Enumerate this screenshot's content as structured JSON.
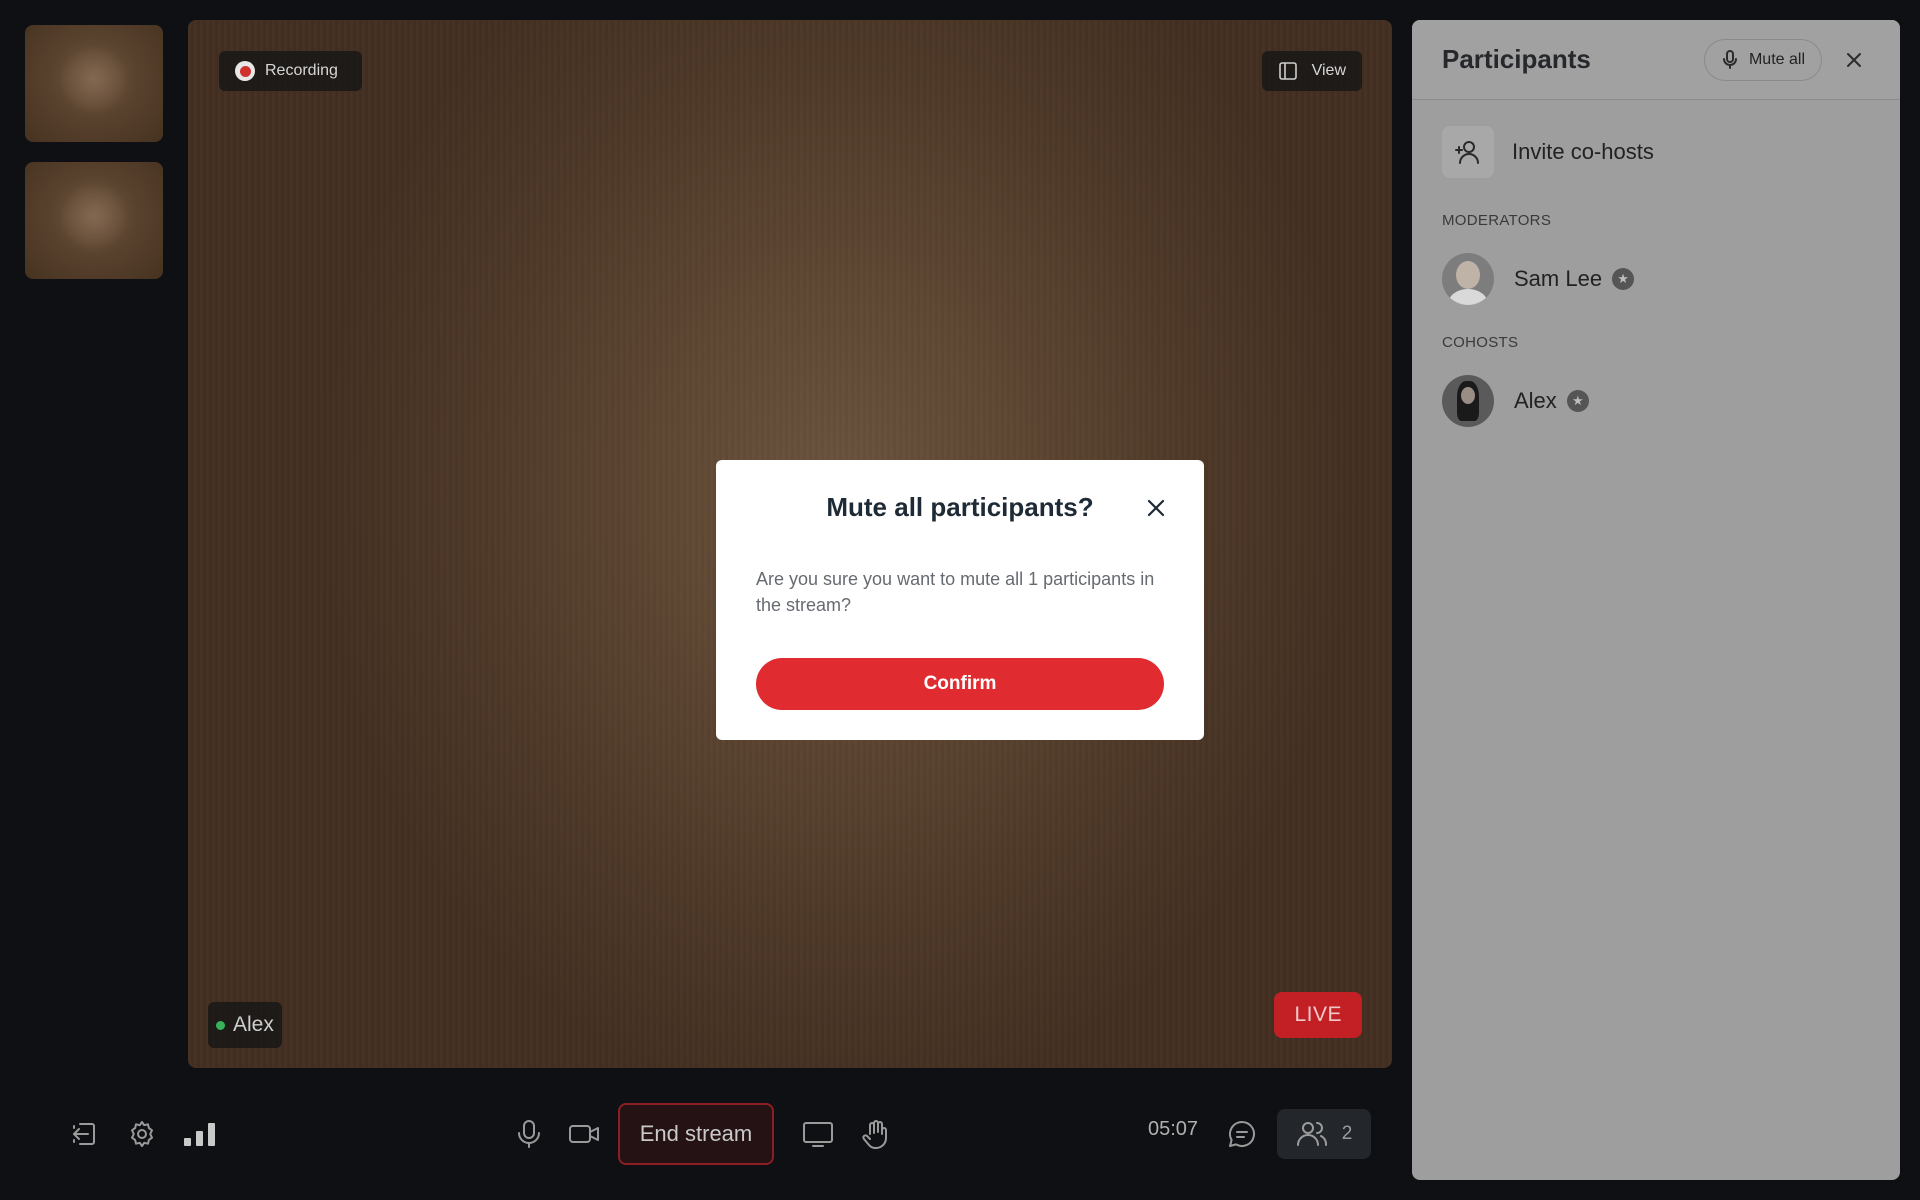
{
  "colors": {
    "accent_red": "#e02c31",
    "live_red": "#c32025",
    "online_green": "#36b35b",
    "panel_bg": "#9e9e9e"
  },
  "stage": {
    "recording_label": "Recording",
    "view_label": "View",
    "speaker_name": "Alex",
    "live_label": "LIVE"
  },
  "toolbar": {
    "end_stream_label": "End stream",
    "timer": "05:07",
    "participant_count": "2"
  },
  "participants_panel": {
    "title": "Participants",
    "mute_all_label": "Mute all",
    "invite_label": "Invite co-hosts",
    "moderators_label": "MODERATORS",
    "cohosts_label": "COHOSTS",
    "moderators": [
      {
        "name": "Sam Lee"
      }
    ],
    "cohosts": [
      {
        "name": "Alex"
      }
    ]
  },
  "modal": {
    "title": "Mute all participants?",
    "body": "Are you sure you want to mute all 1 participants in the stream?",
    "confirm_label": "Confirm"
  }
}
